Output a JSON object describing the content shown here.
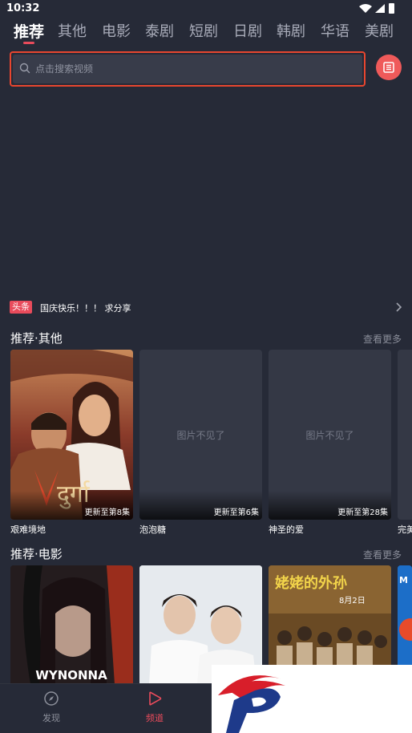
{
  "status_bar": {
    "time": "10:32"
  },
  "tabs": [
    {
      "label": "推荐",
      "active": true
    },
    {
      "label": "其他"
    },
    {
      "label": "电影"
    },
    {
      "label": "泰剧"
    },
    {
      "label": "短剧"
    },
    {
      "label": "日剧"
    },
    {
      "label": "韩剧"
    },
    {
      "label": "华语"
    },
    {
      "label": "美剧"
    }
  ],
  "search": {
    "placeholder": "点击搜索视频",
    "highlight_color": "#e8462f"
  },
  "menu_icon": "list-icon",
  "news": {
    "badge": "头条",
    "text": "国庆快乐！！！ 求分享"
  },
  "sections": [
    {
      "title": "推荐·其他",
      "more": "查看更多",
      "items": [
        {
          "title": "艰难境地",
          "update": "更新至第8集",
          "poster_text": "दुर्गा"
        },
        {
          "title": "泡泡糖",
          "update": "更新至第6集",
          "missing": "图片不见了"
        },
        {
          "title": "神圣的爱",
          "update": "更新至第28集",
          "missing": "图片不见了"
        },
        {
          "title": "完美"
        }
      ]
    },
    {
      "title": "推荐·电影",
      "more": "查看更多",
      "items": [
        {
          "poster_text": "WYNONNA"
        },
        {},
        {
          "poster_text": "姥姥的外孙",
          "poster_subtext": "8月2日"
        },
        {
          "poster_text": "M"
        }
      ]
    }
  ],
  "bottom_nav": [
    {
      "label": "发现",
      "icon": "compass-icon"
    },
    {
      "label": "频道",
      "icon": "play-icon",
      "active": true
    }
  ],
  "colors": {
    "accent": "#e84b5b",
    "background": "#262a37"
  }
}
